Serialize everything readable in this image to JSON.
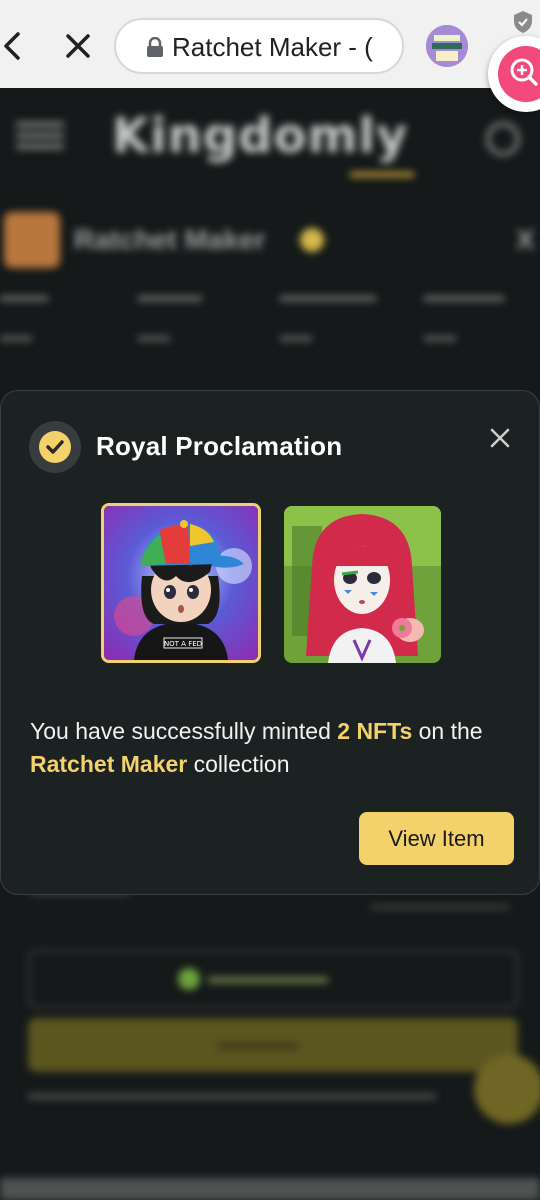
{
  "browser": {
    "url_text": "Ratchet Maker - (",
    "icons": {
      "back": "chevron-left-icon",
      "close": "close-icon",
      "lock": "lock-icon",
      "shield": "shield-icon",
      "zoom": "zoom-in-icon"
    }
  },
  "background": {
    "logo": "Kingdomly",
    "collection_name": "Ratchet Maker",
    "x_label": "X"
  },
  "modal": {
    "title": "Royal Proclamation",
    "message_prefix": "You have successfully minted ",
    "message_count": "2 NFTs",
    "message_middle": " on the ",
    "message_collection": "Ratchet Maker",
    "message_suffix": " collection",
    "view_button": "View Item"
  },
  "colors": {
    "accent": "#f4d26b",
    "modal_bg": "#1c2121",
    "zoom_fab": "#f2497b"
  }
}
